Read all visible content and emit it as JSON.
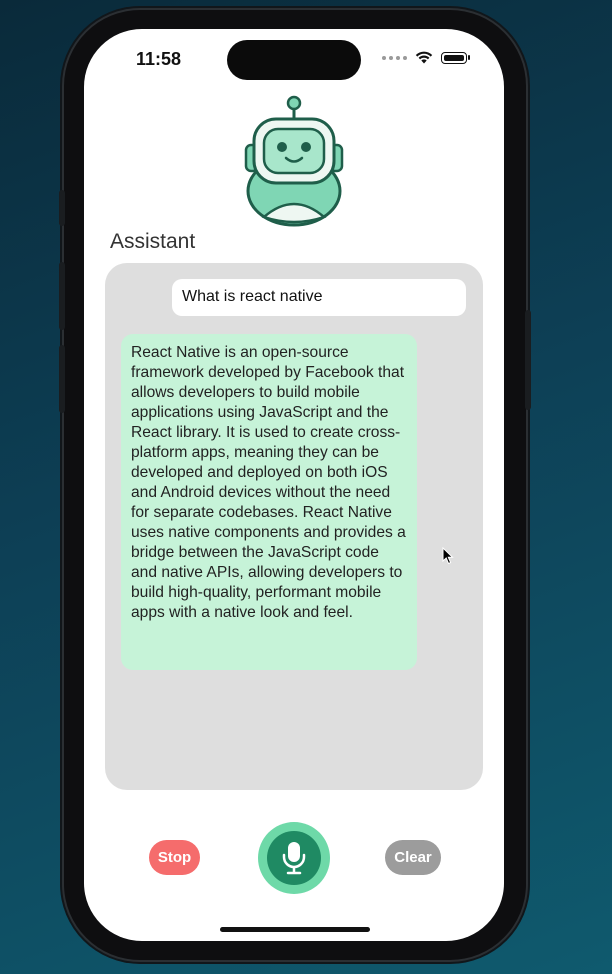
{
  "status_bar": {
    "time": "11:58"
  },
  "header": {
    "title": "Assistant"
  },
  "chat": {
    "messages": [
      {
        "role": "user",
        "text": "What is react native"
      },
      {
        "role": "assistant",
        "text": "React Native is an open-source framework developed by Facebook that allows developers to build mobile applications using JavaScript and the React library. It is used to create cross-platform apps, meaning they can be developed and deployed on both iOS and Android devices without the need for separate codebases. React Native uses native components and provides a bridge between the JavaScript code and native APIs, allowing developers to build high-quality, performant mobile apps with a native look and feel."
      }
    ]
  },
  "controls": {
    "stop_label": "Stop",
    "clear_label": "Clear",
    "mic_icon": "microphone-icon"
  },
  "colors": {
    "bot_bubble": "#c6f3d8",
    "stop": "#f56c6c",
    "mic": "#1f8a63",
    "mic_ring": "#6ed9a8",
    "clear": "#9c9c9c",
    "chat_background": "#dedede"
  }
}
